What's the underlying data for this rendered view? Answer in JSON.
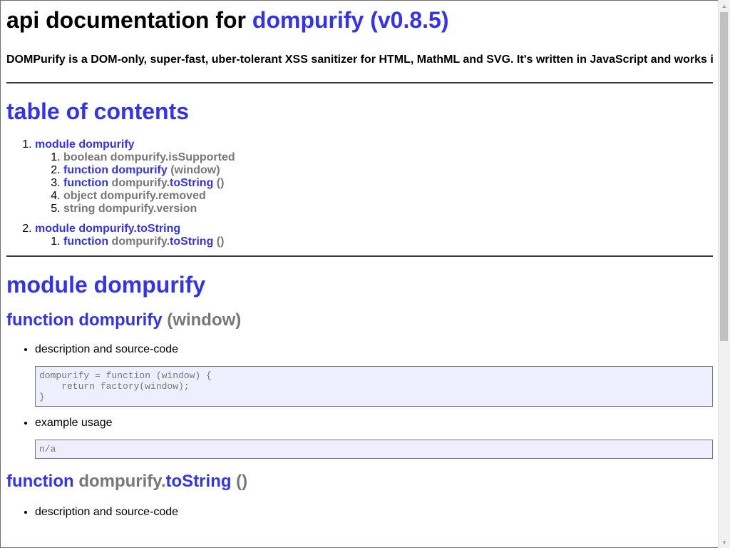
{
  "header": {
    "title_prefix": "api documentation for ",
    "title_link": "dompurify (v0.8.5)",
    "description": "DOMPurify is a DOM-only, super-fast, uber-tolerant XSS sanitizer for HTML, MathML and SVG. It's written in JavaScript and works in all modern browsers (Safari, Opera (15+), Internet Explorer (10+), Firefox and Chrome - as well as almost anything else usin"
  },
  "toc": {
    "title": "table of contents",
    "modules": [
      {
        "label": "module dompurify",
        "items": [
          {
            "type": "boolean",
            "name": "dompurify.isSupported",
            "args": "",
            "type_link": false,
            "name_prefix": "",
            "name_link": false
          },
          {
            "type": "function",
            "name": "dompurify",
            "args": " (window)",
            "type_link": true,
            "name_prefix": "",
            "name_link": true
          },
          {
            "type": "function",
            "name_prefix": "dompurify.",
            "name": "toString",
            "args": " ()",
            "type_link": true,
            "name_link": true
          },
          {
            "type": "object",
            "name": "dompurify.removed",
            "args": "",
            "type_link": false,
            "name_prefix": "",
            "name_link": false
          },
          {
            "type": "string",
            "name": "dompurify.version",
            "args": "",
            "type_link": false,
            "name_prefix": "",
            "name_link": false
          }
        ]
      },
      {
        "label": "module dompurify.toString",
        "items": [
          {
            "type": "function",
            "name_prefix": "dompurify.",
            "name": "toString",
            "args": " ()",
            "type_link": true,
            "name_link": true
          }
        ]
      }
    ]
  },
  "module": {
    "title": "module dompurify",
    "functions": [
      {
        "keyword": "function",
        "name_prefix": "",
        "name": "dompurify",
        "args": " (window)",
        "desc_label": "description and source-code",
        "source": "dompurify = function (window) {\n    return factory(window);\n}",
        "example_label": "example usage",
        "example": "n/a"
      },
      {
        "keyword": "function",
        "name_prefix": "dompurify.",
        "name": "toString",
        "args": " ()",
        "desc_label": "description and source-code"
      }
    ]
  },
  "colors": {
    "accent": "#3333ee",
    "muted": "#777777",
    "code_bg": "#eeeeff"
  }
}
